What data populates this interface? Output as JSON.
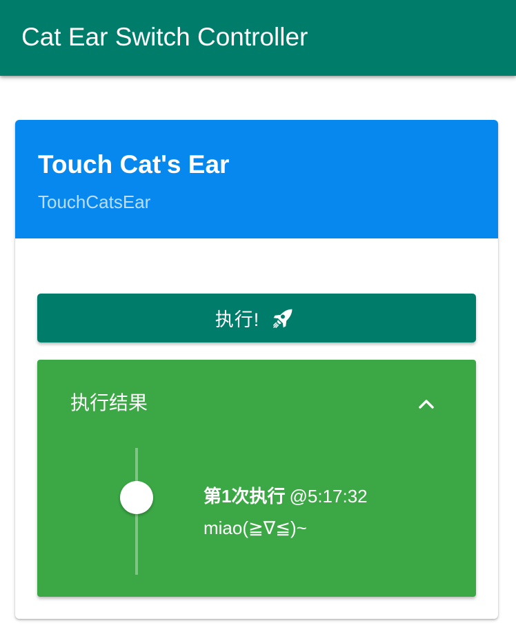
{
  "app_bar": {
    "title": "Cat Ear Switch Controller"
  },
  "card": {
    "title": "Touch Cat's Ear",
    "subtitle": "TouchCatsEar",
    "run_button": {
      "label": "执行!",
      "icon": "rocket-icon"
    },
    "result_panel": {
      "title": "执行结果",
      "toggle_icon": "chevron-up-icon",
      "entries": [
        {
          "index_label": "第1次执行",
          "time": "@5:17:32",
          "message": "miao(≧∇≦)~"
        }
      ]
    }
  },
  "colors": {
    "app_bar": "#007d6a",
    "card_header": "#0788ef",
    "run_button": "#007d6a",
    "result_panel": "#3ba845"
  }
}
